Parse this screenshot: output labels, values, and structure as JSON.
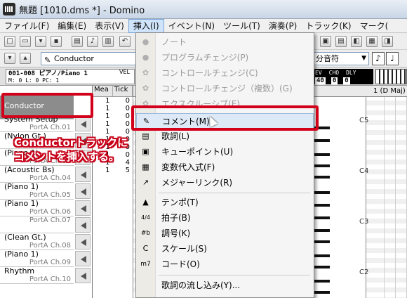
{
  "window": {
    "title": "無題 [1010.dms *] - Domino"
  },
  "menubar": {
    "items": [
      {
        "label": "ファイル(F)"
      },
      {
        "label": "編集(E)"
      },
      {
        "label": "表示(V)"
      },
      {
        "label": "挿入(I)",
        "active": true
      },
      {
        "label": "イベント(N)"
      },
      {
        "label": "ツール(T)"
      },
      {
        "label": "演奏(P)"
      },
      {
        "label": "トラック(K)"
      },
      {
        "label": "マーク("
      }
    ]
  },
  "toolbar": {
    "track_select_value": "Conductor",
    "note_length_value": "分音符"
  },
  "info": {
    "instrument_line": "001-008 ピアノ/Piano 1",
    "position_line": "M:   0   L:   0  PC:   1",
    "vel_label": "VEL",
    "event_labels": [
      "EV",
      "CHO",
      "DLY"
    ],
    "event_values": [
      "40",
      "0",
      "0"
    ]
  },
  "tracks": [
    {
      "name": "Conductor",
      "port": "",
      "selected": true
    },
    {
      "name": "System Setup",
      "port": "PortA  Ch.01"
    },
    {
      "name": "(Nylon Gt.)",
      "port": "PortA  Ch.02"
    },
    {
      "name": "(Piano 1)",
      "port": "PortA  Ch.03"
    },
    {
      "name": "(Acoustic Bs)",
      "port": "PortA  Ch.04"
    },
    {
      "name": "(Piano 1)",
      "port": "PortA  Ch.05"
    },
    {
      "name": "(Piano 1)",
      "port": "PortA  Ch.06"
    },
    {
      "name": "",
      "port": "PortA  Ch.07"
    },
    {
      "name": "(Clean Gt.)",
      "port": "PortA  Ch.08"
    },
    {
      "name": "(Piano 1)",
      "port": "PortA  Ch.09"
    },
    {
      "name": "Rhythm",
      "port": "PortA  Ch.10"
    }
  ],
  "event_list": {
    "headers": [
      "Mea",
      "Tick"
    ],
    "rows": [
      [
        "1",
        "0"
      ],
      [
        "1",
        "0"
      ],
      [
        "1",
        "0"
      ],
      [
        "1",
        "0"
      ],
      [
        "1",
        "0"
      ],
      [
        "1",
        "0"
      ],
      [
        "1",
        "0"
      ],
      [
        "1",
        "0"
      ],
      [
        "1",
        "4"
      ],
      [
        "1",
        "5"
      ]
    ]
  },
  "piano_roll": {
    "key_signature": "1 (D Maj)",
    "octave_labels": [
      "C5",
      "C4",
      "C3",
      "C2"
    ]
  },
  "insert_menu": {
    "items": [
      {
        "label": "ノート",
        "icon": "circle-icon",
        "glyph": "●",
        "disabled": true
      },
      {
        "label": "プログラムチェンジ(P)",
        "icon": "program-change-icon",
        "glyph": "●",
        "disabled": true
      },
      {
        "label": "コントロールチェンジ(C)",
        "icon": "gear-icon",
        "glyph": "✿",
        "disabled": true
      },
      {
        "label": "コントロールチェンジ（複数）(G)",
        "icon": "gear-multi-icon",
        "glyph": "✿",
        "disabled": true
      },
      {
        "label": "エクスクルーシブ(E)",
        "icon": "exclusive-icon",
        "glyph": "✿",
        "disabled": true
      },
      {
        "label": "コメント(M)",
        "icon": "comment-icon",
        "glyph": "✎",
        "hover": true
      },
      {
        "label": "歌詞(L)",
        "icon": "lyrics-icon",
        "glyph": "▤"
      },
      {
        "label": "キューポイント(U)",
        "icon": "cue-point-icon",
        "glyph": "▣"
      },
      {
        "label": "変数代入式(F)",
        "icon": "variable-icon",
        "glyph": "▦"
      },
      {
        "label": "メジャーリンク(R)",
        "icon": "link-arrow-icon",
        "glyph": "↗"
      },
      {
        "label": "テンポ(T)",
        "icon": "metronome-icon",
        "glyph": "▲"
      },
      {
        "label": "拍子(B)",
        "icon": "time-signature-icon",
        "glyph": "4/4"
      },
      {
        "label": "調号(K)",
        "icon": "key-signature-icon",
        "glyph": "#b"
      },
      {
        "label": "スケール(S)",
        "icon": "scale-icon",
        "glyph": "C"
      },
      {
        "label": "コード(O)",
        "icon": "chord-icon",
        "glyph": "m7"
      },
      {
        "label": "歌詞の流し込み(Y)...",
        "icon": "",
        "glyph": ""
      }
    ]
  },
  "annotation": {
    "line1": "Conductorトラックに",
    "line2": "コメントを挿入する。",
    "color": "#d2001a"
  }
}
